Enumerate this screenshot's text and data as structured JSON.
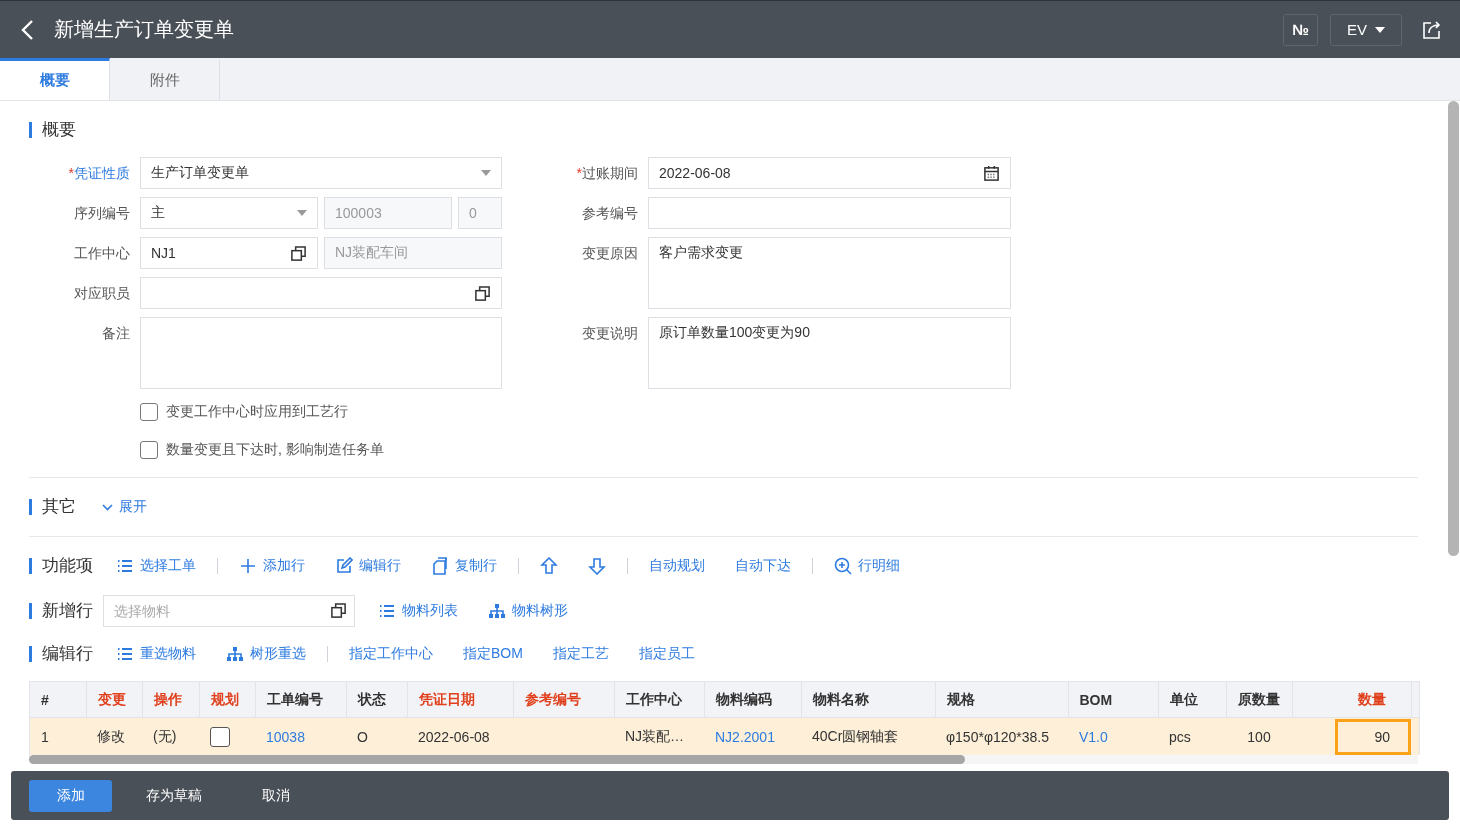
{
  "header": {
    "title": "新增生产订单变更单",
    "number_button": "№",
    "version_select": "EV"
  },
  "tabs": [
    {
      "label": "概要",
      "selected": true
    },
    {
      "label": "附件",
      "selected": false
    }
  ],
  "overview": {
    "title": "概要",
    "left_fields": [
      {
        "kind": "select",
        "required_mark": "*",
        "link": true,
        "label": "凭证性质",
        "value": "生产订单变更单"
      },
      {
        "kind": "series",
        "link": false,
        "label": "序列编号",
        "value": "主",
        "number": "100003",
        "suffix": "0"
      },
      {
        "kind": "pair",
        "link": false,
        "label": "工作中心",
        "value": "NJ1",
        "name": "NJ装配车间"
      },
      {
        "kind": "lookup",
        "link": false,
        "label": "对应职员"
      },
      {
        "kind": "textarea",
        "link": false,
        "label": "备注"
      }
    ],
    "right_fields": [
      {
        "kind": "date",
        "required_mark": "*",
        "link": false,
        "label": "过账期间",
        "value": "2022-06-08"
      },
      {
        "kind": "text",
        "link": false,
        "label": "参考编号"
      },
      {
        "kind": "textarea",
        "link": false,
        "label": "变更原因",
        "value": "客户需求变更"
      },
      {
        "kind": "textarea",
        "link": false,
        "label": "变更说明",
        "value": "原订单数量100变更为90"
      }
    ],
    "checkboxes": [
      {
        "label": "变更工作中心时应用到工艺行",
        "checked": false
      },
      {
        "label": "数量变更且下达时, 影响制造任务单",
        "checked": false
      }
    ]
  },
  "other": {
    "title": "其它",
    "toggle": "展开",
    "expanded": false
  },
  "function_bar": {
    "title": "功能项",
    "items": [
      {
        "kind": "list",
        "label": "选择工单"
      },
      {
        "kind": "divider"
      },
      {
        "kind": "plus",
        "label": "添加行"
      },
      {
        "kind": "edit",
        "label": "编辑行"
      },
      {
        "kind": "copy",
        "label": "复制行"
      },
      {
        "kind": "divider"
      },
      {
        "kind": "up"
      },
      {
        "kind": "down"
      },
      {
        "kind": "divider"
      },
      {
        "kind": "text",
        "label": "自动规划"
      },
      {
        "kind": "text",
        "label": "自动下达"
      },
      {
        "kind": "divider"
      },
      {
        "kind": "zoom",
        "label": "行明细"
      }
    ]
  },
  "new_row": {
    "title": "新增行",
    "placeholder": "选择物料",
    "items": [
      {
        "kind": "list",
        "label": "物料列表"
      },
      {
        "kind": "tree",
        "label": "物料树形"
      }
    ]
  },
  "edit_row": {
    "title": "编辑行",
    "items": [
      {
        "kind": "list",
        "label": "重选物料"
      },
      {
        "kind": "tree",
        "label": "树形重选"
      },
      {
        "kind": "divider"
      },
      {
        "kind": "text",
        "label": "指定工作中心"
      },
      {
        "kind": "text",
        "label": "指定BOM"
      },
      {
        "kind": "text",
        "label": "指定工艺"
      },
      {
        "kind": "text",
        "label": "指定员工"
      }
    ]
  },
  "table": {
    "columns": [
      {
        "label": "#",
        "required": false
      },
      {
        "label": "变更",
        "required": true
      },
      {
        "label": "操作",
        "required": true
      },
      {
        "label": "规划",
        "required": true
      },
      {
        "label": "工单编号",
        "required": false
      },
      {
        "label": "状态",
        "required": false
      },
      {
        "label": "凭证日期",
        "required": true
      },
      {
        "label": "参考编号",
        "required": true
      },
      {
        "label": "工作中心",
        "required": false
      },
      {
        "label": "物料编码",
        "required": false
      },
      {
        "label": "物料名称",
        "required": false
      },
      {
        "label": "规格",
        "required": false
      },
      {
        "label": "BOM",
        "required": false
      },
      {
        "label": "单位",
        "required": false
      },
      {
        "label": "原数量",
        "required": false
      },
      {
        "label": "数量",
        "required": true
      }
    ],
    "rows": [
      {
        "selected": true,
        "cells": [
          {
            "kind": "text",
            "text": "1"
          },
          {
            "kind": "text",
            "text": "修改"
          },
          {
            "kind": "text",
            "text": "(无)"
          },
          {
            "kind": "check",
            "checked": false
          },
          {
            "kind": "link",
            "text": "10038"
          },
          {
            "kind": "text",
            "text": "O"
          },
          {
            "kind": "text",
            "text": "2022-06-08"
          },
          {
            "kind": "text"
          },
          {
            "kind": "text",
            "text": "NJ装配…"
          },
          {
            "kind": "link",
            "text": "NJ2.2001"
          },
          {
            "kind": "text",
            "text": "40Cr圆钢轴套"
          },
          {
            "kind": "text",
            "text": "φ150*φ120*38.5"
          },
          {
            "kind": "link",
            "text": "V1.0"
          },
          {
            "kind": "text",
            "text": "pcs"
          },
          {
            "kind": "number",
            "text": "100"
          },
          {
            "kind": "focus",
            "text": "90"
          }
        ]
      }
    ]
  },
  "footer": {
    "buttons": [
      {
        "kind": "primary",
        "label": "添加"
      },
      {
        "kind": "plain",
        "label": "存为草稿"
      },
      {
        "kind": "plain",
        "label": "取消"
      }
    ]
  }
}
